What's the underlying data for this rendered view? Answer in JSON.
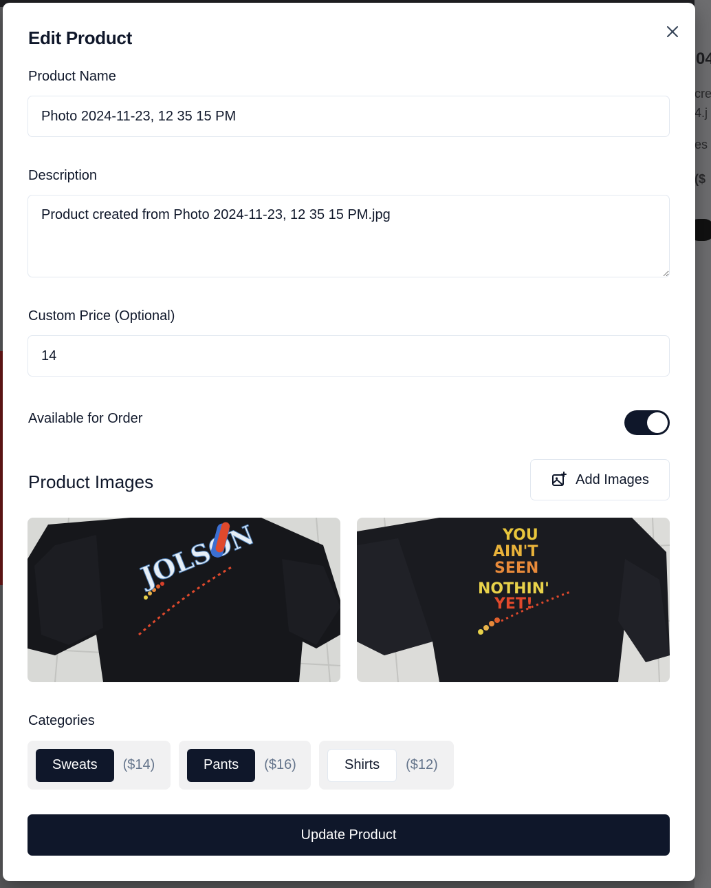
{
  "background": {
    "fragments": [
      "04",
      "cre",
      "4.j",
      "es",
      "($"
    ]
  },
  "dialog": {
    "title": "Edit Product",
    "close_icon": "close-icon"
  },
  "form": {
    "name_label": "Product Name",
    "name_value": "Photo 2024-11-23, 12 35 15 PM",
    "description_label": "Description",
    "description_value": "Product created from Photo 2024-11-23, 12 35 15 PM.jpg",
    "price_label": "Custom Price (Optional)",
    "price_value": "14",
    "available_label": "Available for Order",
    "available_on": true
  },
  "images": {
    "title": "Product Images",
    "add_label": "Add Images",
    "add_icon": "image-plus-icon",
    "items": [
      {
        "name": "product-image-jolson",
        "print": "JOLSON"
      },
      {
        "name": "product-image-you-aint-seen-nothin-yet",
        "print": [
          "YOU",
          "AIN'T",
          "SEEN",
          "NOTHIN'",
          "YET!"
        ]
      }
    ]
  },
  "categories": {
    "title": "Categories",
    "items": [
      {
        "label": "Sweats",
        "price": "($14)",
        "selected": true
      },
      {
        "label": "Pants",
        "price": "($16)",
        "selected": true
      },
      {
        "label": "Shirts",
        "price": "($12)",
        "selected": false
      }
    ]
  },
  "submit_label": "Update Product",
  "colors": {
    "primary": "#0f172a",
    "border": "#e2e8f0",
    "muted": "#64748b",
    "group_bg": "#f1f1f2"
  }
}
